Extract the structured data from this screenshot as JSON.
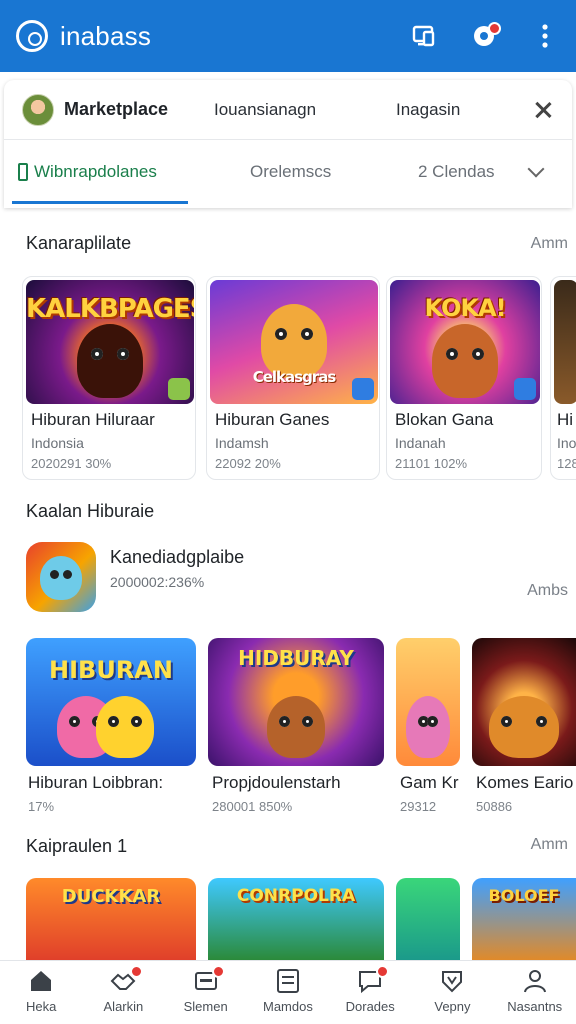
{
  "app": {
    "title": "inabass",
    "accent": "#1976d2"
  },
  "sheet": {
    "title": "Marketplace",
    "link1": "Iouansianagn",
    "link2": "Inagasin",
    "tabs": [
      {
        "label": "Wibnrapdolanes",
        "active": true
      },
      {
        "label": "Orelemscs",
        "active": false
      },
      {
        "label": "2 Clendas",
        "active": false
      }
    ]
  },
  "section1": {
    "title": "Kanaraplilate",
    "more": "Amm",
    "cards": [
      {
        "art_text": "KALKBPAGES",
        "name": "Hiburan Hiluraar",
        "sub": "Indonsia",
        "meta": "2020291 30%"
      },
      {
        "art_text": "Celkasgras",
        "name": "Hiburan Ganes",
        "sub": "Indamsh",
        "meta": "22092 20%"
      },
      {
        "art_text": "KOKA!",
        "name": "Blokan Gana",
        "sub": "Indanah",
        "meta": "21101 102%"
      },
      {
        "name": "Hi",
        "sub": "Ino",
        "meta": "128"
      }
    ]
  },
  "section2": {
    "title": "Kaalan Hiburaie",
    "featured": {
      "name": "Kanediadgplaibe",
      "meta": "2000002:236%"
    },
    "more": "Ambs",
    "tiles": [
      {
        "art_text": "HIBURAN",
        "name": "Hiburan Loibbran:",
        "meta": "17%"
      },
      {
        "art_text": "HIDBURAY",
        "name": "Propjdoulenstarh",
        "meta": "280001 850%"
      },
      {
        "name": "Gam Kr",
        "meta": "29312"
      },
      {
        "name": "Komes Eario",
        "meta": "50886"
      }
    ]
  },
  "section3": {
    "title": "Kaipraulen 1",
    "more": "Amm",
    "tiles": [
      {
        "art_text": "DUCKKAR"
      },
      {
        "art_text": "CONRPOLRA"
      },
      {},
      {
        "art_text": "BOLOEF"
      }
    ]
  },
  "bottom_nav": [
    {
      "label": "Heka",
      "icon": "home-icon"
    },
    {
      "label": "Alarkin",
      "icon": "handshake-icon"
    },
    {
      "label": "Slemen",
      "icon": "cart-icon"
    },
    {
      "label": "Mamdos",
      "icon": "grid-icon"
    },
    {
      "label": "Dorades",
      "icon": "chat-icon"
    },
    {
      "label": "Vepny",
      "icon": "shield-icon"
    },
    {
      "label": "Nasantns",
      "icon": "person-icon"
    }
  ]
}
